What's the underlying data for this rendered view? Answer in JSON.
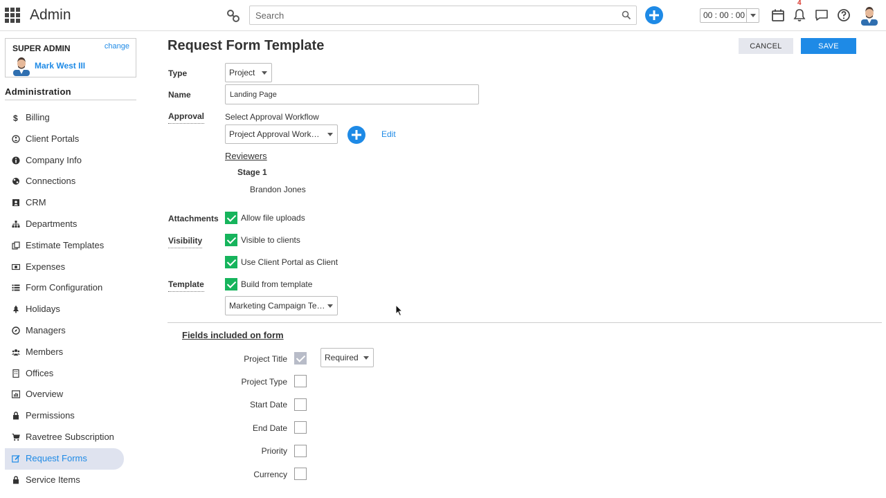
{
  "header": {
    "app_title": "Admin",
    "search_placeholder": "Search",
    "timer": "00 : 00 : 00",
    "notification_count": "4",
    "icons": [
      "apps-grid-icon",
      "link-icon",
      "search-icon",
      "add-icon",
      "calendar-icon",
      "bell-icon",
      "chat-icon",
      "help-icon",
      "user-avatar-icon"
    ]
  },
  "sidebar": {
    "role": "SUPER ADMIN",
    "change_label": "change",
    "user_name": "Mark West III",
    "section_title": "Administration",
    "items": [
      {
        "label": "Billing",
        "icon": "dollar-icon"
      },
      {
        "label": "Client Portals",
        "icon": "portal-icon"
      },
      {
        "label": "Company Info",
        "icon": "info-icon"
      },
      {
        "label": "Connections",
        "icon": "connections-icon"
      },
      {
        "label": "CRM",
        "icon": "contact-card-icon"
      },
      {
        "label": "Departments",
        "icon": "sitemap-icon"
      },
      {
        "label": "Estimate Templates",
        "icon": "copy-icon"
      },
      {
        "label": "Expenses",
        "icon": "money-icon"
      },
      {
        "label": "Form Configuration",
        "icon": "list-icon"
      },
      {
        "label": "Holidays",
        "icon": "tree-icon"
      },
      {
        "label": "Managers",
        "icon": "compass-icon"
      },
      {
        "label": "Members",
        "icon": "users-icon"
      },
      {
        "label": "Offices",
        "icon": "building-icon"
      },
      {
        "label": "Overview",
        "icon": "bar-chart-icon"
      },
      {
        "label": "Permissions",
        "icon": "lock-icon"
      },
      {
        "label": "Ravetree Subscription",
        "icon": "cart-icon"
      },
      {
        "label": "Request Forms",
        "icon": "edit-icon"
      },
      {
        "label": "Service Items",
        "icon": "lock-icon"
      }
    ],
    "active_item": "Request Forms"
  },
  "main": {
    "title": "Request Form Template",
    "cancel_label": "CANCEL",
    "save_label": "SAVE",
    "type_label": "Type",
    "type_value": "Project",
    "name_label": "Name",
    "name_value": "Landing Page",
    "approval_label": "Approval",
    "approval_hint": "Select Approval Workflow",
    "approval_value": "Project Approval Work…",
    "edit_label": "Edit",
    "reviewers_label": "Reviewers",
    "stage_label": "Stage 1",
    "reviewer_name": "Brandon Jones",
    "attachments_label": "Attachments",
    "allow_uploads_label": "Allow file uploads",
    "visibility_label": "Visibility",
    "visible_clients_label": "Visible to clients",
    "client_portal_label": "Use Client Portal as Client",
    "template_label": "Template",
    "build_template_label": "Build from template",
    "template_value": "Marketing Campaign Te…",
    "fields_title": "Fields included on form",
    "fields": [
      {
        "label": "Project Title",
        "state": "disabled-checked",
        "requirement": "Required"
      },
      {
        "label": "Project Type",
        "state": "unchecked"
      },
      {
        "label": "Start Date",
        "state": "unchecked"
      },
      {
        "label": "End Date",
        "state": "unchecked"
      },
      {
        "label": "Priority",
        "state": "unchecked"
      },
      {
        "label": "Currency",
        "state": "unchecked"
      }
    ]
  },
  "colors": {
    "accent": "#1e8ae6",
    "check_green": "#16b45c",
    "active_nav_bg": "#dfe3ef",
    "notification_red": "#d9342b"
  }
}
